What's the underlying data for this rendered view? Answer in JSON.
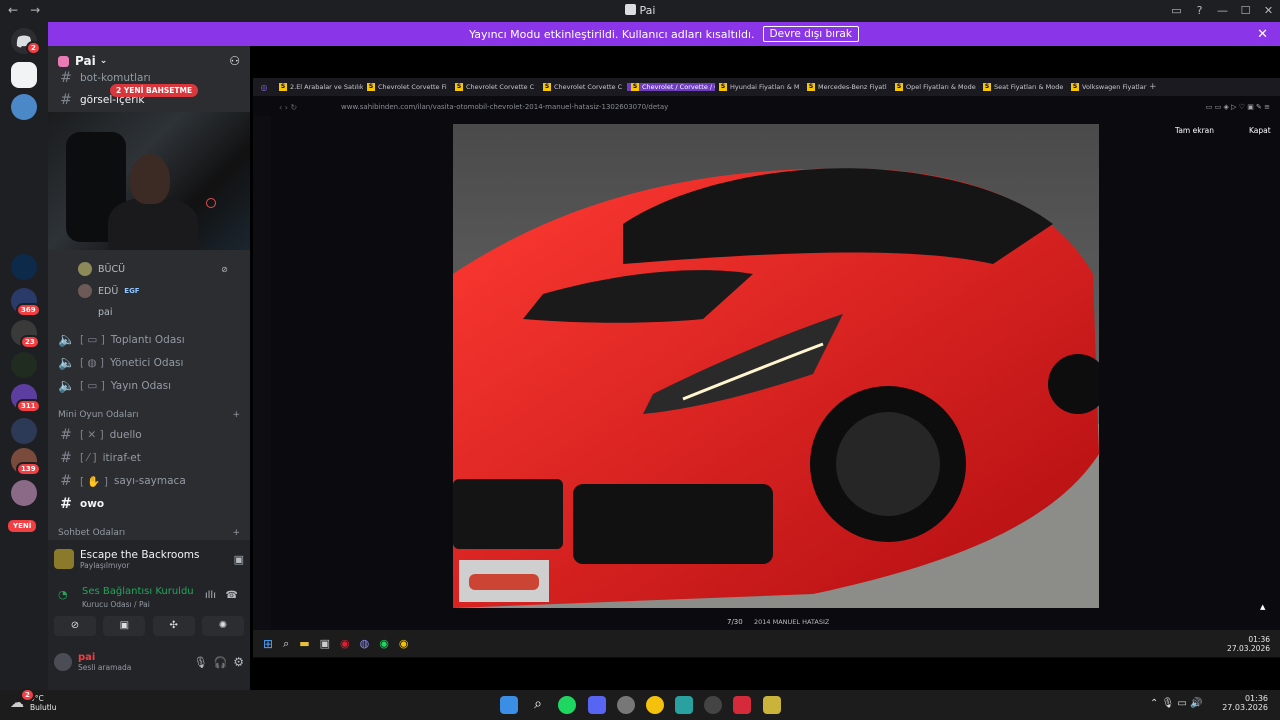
{
  "window": {
    "title": "Pai"
  },
  "banner": {
    "text": "Yayıncı Modu etkinleştirildi. Kullanıcı adları kısaltıldı.",
    "button": "Devre dışı bırak"
  },
  "servers": {
    "badges": [
      "2",
      "369",
      "23",
      "311",
      "139"
    ],
    "new_label": "YENİ"
  },
  "guild": {
    "name": "Pai"
  },
  "bet_tag": "2 YENİ BAHSETME",
  "channels_top": [
    {
      "label": "bot-komutları"
    },
    {
      "label": "görsel-içerik"
    }
  ],
  "voice_users": [
    {
      "name": "BÜCÜ",
      "tag": ""
    },
    {
      "name": "EDÜ",
      "tag": "EGF"
    },
    {
      "name": "pai",
      "tag": ""
    }
  ],
  "voice_channels": [
    "Toplantı Odası",
    "Yönetici Odası",
    "Yayın Odası"
  ],
  "mini_category": "Mini Oyun Odaları",
  "mini_channels": [
    "duello",
    "itiraf-et",
    "sayı-saymaca",
    "owo"
  ],
  "chat_category": "Sohbet Odaları",
  "activity": {
    "game": "Escape the Backrooms",
    "status": "Paylaşılmıyor"
  },
  "voice": {
    "title": "Ses Bağlantısı Kuruldu",
    "channel": "Kurucu Odası / Pai"
  },
  "user": {
    "name": "pai",
    "status": "Sesli aramada"
  },
  "browser": {
    "tabs": [
      "2.El Arabalar ve Satılık",
      "Chevrolet Corvette Fi",
      "Chevrolet Corvette C",
      "Chevrolet Corvette C",
      "Chevrolet / Corvette / C7",
      "Hyundai Fiyatları & M",
      "Mercedes-Benz Fiyatl",
      "Opel Fiyatları & Mode",
      "Seat Fiyatları & Mode",
      "Volkswagen Fiyatları"
    ],
    "url": "www.sahibinden.com/ilan/vasita-otomobil-chevrolet-2014-manuel-hatasiz-1302603070/detay",
    "listing_id": "#1302603070",
    "fullscreen": "Tam ekran",
    "close": "Kapat",
    "counter": "7/30",
    "caption": "2014 MANUEL HATASIZ",
    "clock_time": "01:36",
    "clock_date": "27.03.2026"
  },
  "taskbar": {
    "weather_temp": "9°C",
    "weather_desc": "Bulutlu",
    "time": "01:36",
    "date": "27.03.2026",
    "weather_badge": "2"
  }
}
